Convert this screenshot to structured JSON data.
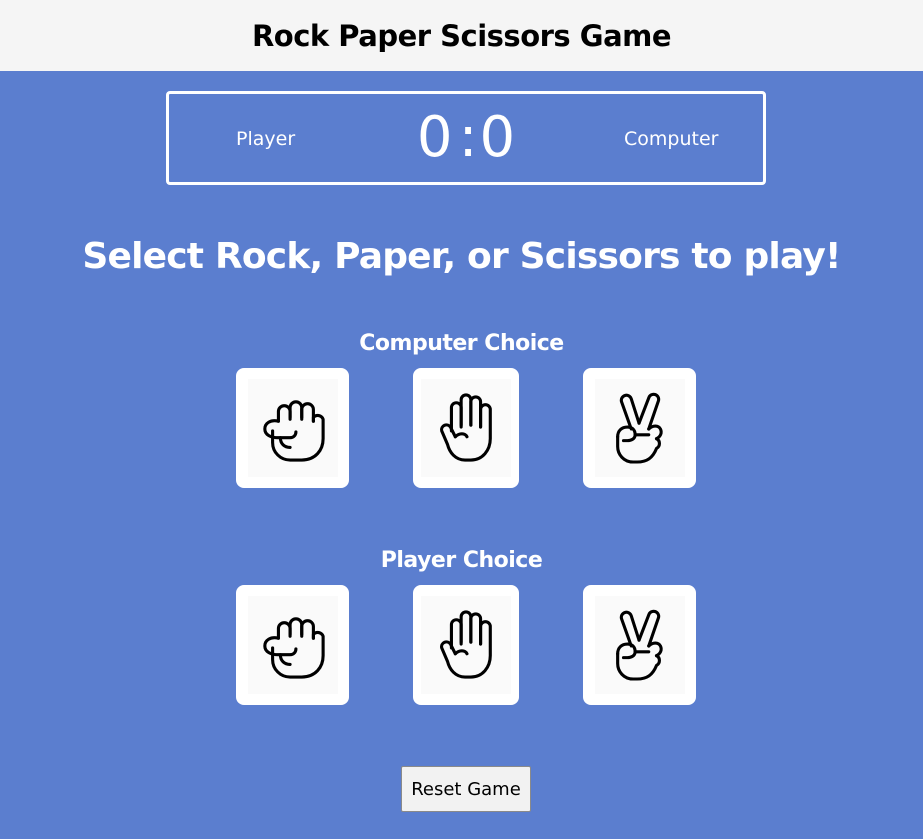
{
  "header": {
    "title": "Rock Paper Scissors Game"
  },
  "scoreboard": {
    "player_label": "Player",
    "computer_label": "Computer",
    "player_score": "0",
    "separator": ":",
    "computer_score": "0"
  },
  "prompt": "Select Rock, Paper, or Scissors to play!",
  "computer_section": {
    "title": "Computer Choice",
    "choices": [
      "rock-icon",
      "paper-icon",
      "scissors-icon"
    ]
  },
  "player_section": {
    "title": "Player Choice",
    "choices": [
      "rock-icon",
      "paper-icon",
      "scissors-icon"
    ]
  },
  "reset_button": {
    "label": "Reset Game"
  },
  "colors": {
    "background": "#5b7ecf",
    "header_bg": "#f5f5f5",
    "card_bg": "#ffffff",
    "text_light": "#ffffff"
  }
}
